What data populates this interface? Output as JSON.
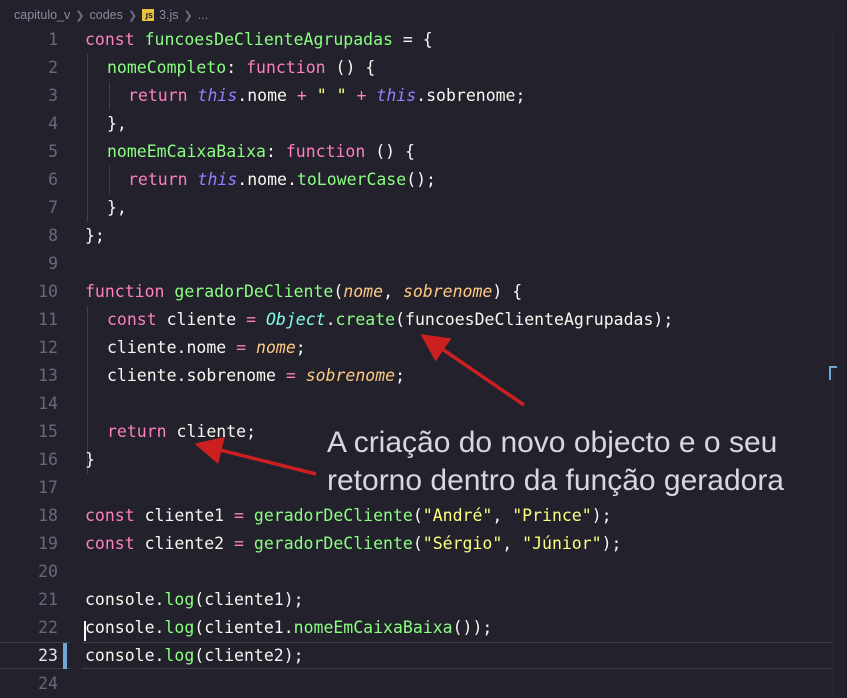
{
  "breadcrumb": {
    "items": [
      "capitulo_v",
      "codes",
      "3.js",
      "..."
    ],
    "file_badge": "JS"
  },
  "editor": {
    "active_line": 23,
    "line_numbers": [
      "1",
      "2",
      "3",
      "4",
      "5",
      "6",
      "7",
      "8",
      "9",
      "10",
      "11",
      "12",
      "13",
      "14",
      "15",
      "16",
      "17",
      "18",
      "19",
      "20",
      "21",
      "22",
      "23",
      "24"
    ],
    "code": {
      "l1": [
        "const",
        " ",
        "funcoesDeClienteAgrupadas",
        " = {"
      ],
      "l2": [
        "nomeCompleto",
        ": ",
        "function",
        " () {"
      ],
      "l3": [
        "return",
        " ",
        "this",
        ".nome ",
        "+",
        " ",
        "\" \"",
        " ",
        "+",
        " ",
        "this",
        ".sobrenome;"
      ],
      "l4": [
        "},"
      ],
      "l5": [
        "nomeEmCaixaBaixa",
        ": ",
        "function",
        " () {"
      ],
      "l6": [
        "return",
        " ",
        "this",
        ".nome.",
        "toLowerCase",
        "();"
      ],
      "l7": [
        "},"
      ],
      "l8": [
        "};"
      ],
      "l10": [
        "function",
        " ",
        "geradorDeCliente",
        "(",
        "nome",
        ", ",
        "sobrenome",
        ") {"
      ],
      "l11": [
        "const",
        " cliente ",
        "=",
        " ",
        "Object",
        ".",
        "create",
        "(funcoesDeClienteAgrupadas);"
      ],
      "l12": [
        "cliente.nome ",
        "=",
        " ",
        "nome",
        ";"
      ],
      "l13": [
        "cliente.sobrenome ",
        "=",
        " ",
        "sobrenome",
        ";"
      ],
      "l15": [
        "return",
        " cliente;"
      ],
      "l16": [
        "}"
      ],
      "l18": [
        "const",
        " cliente1 ",
        "=",
        " ",
        "geradorDeCliente",
        "(",
        "\"André\"",
        ", ",
        "\"Prince\"",
        ");"
      ],
      "l19": [
        "const",
        " cliente2 ",
        "=",
        " ",
        "geradorDeCliente",
        "(",
        "\"Sérgio\"",
        ", ",
        "\"Júnior\"",
        ");"
      ],
      "l21": [
        "console.",
        "log",
        "(cliente1);"
      ],
      "l22": [
        "console.",
        "log",
        "(cliente1.",
        "nomeEmCaixaBaixa",
        "());"
      ],
      "l23": [
        "console.",
        "log",
        "(cliente2);"
      ]
    }
  },
  "annotation": {
    "line1": "A criação do novo objecto e o seu",
    "line2": "retorno dentro da função geradora"
  },
  "colors": {
    "background": "#22212c",
    "keyword": "#ff80bf",
    "function": "#8aff80",
    "string": "#ffff80",
    "this": "#9580ff",
    "param": "#ffca80",
    "class": "#80ffea",
    "arrow": "#cc1f1f",
    "annotation_text": "#d8d6e0"
  },
  "icons": [
    "chevron-right-icon",
    "js-file-icon"
  ]
}
